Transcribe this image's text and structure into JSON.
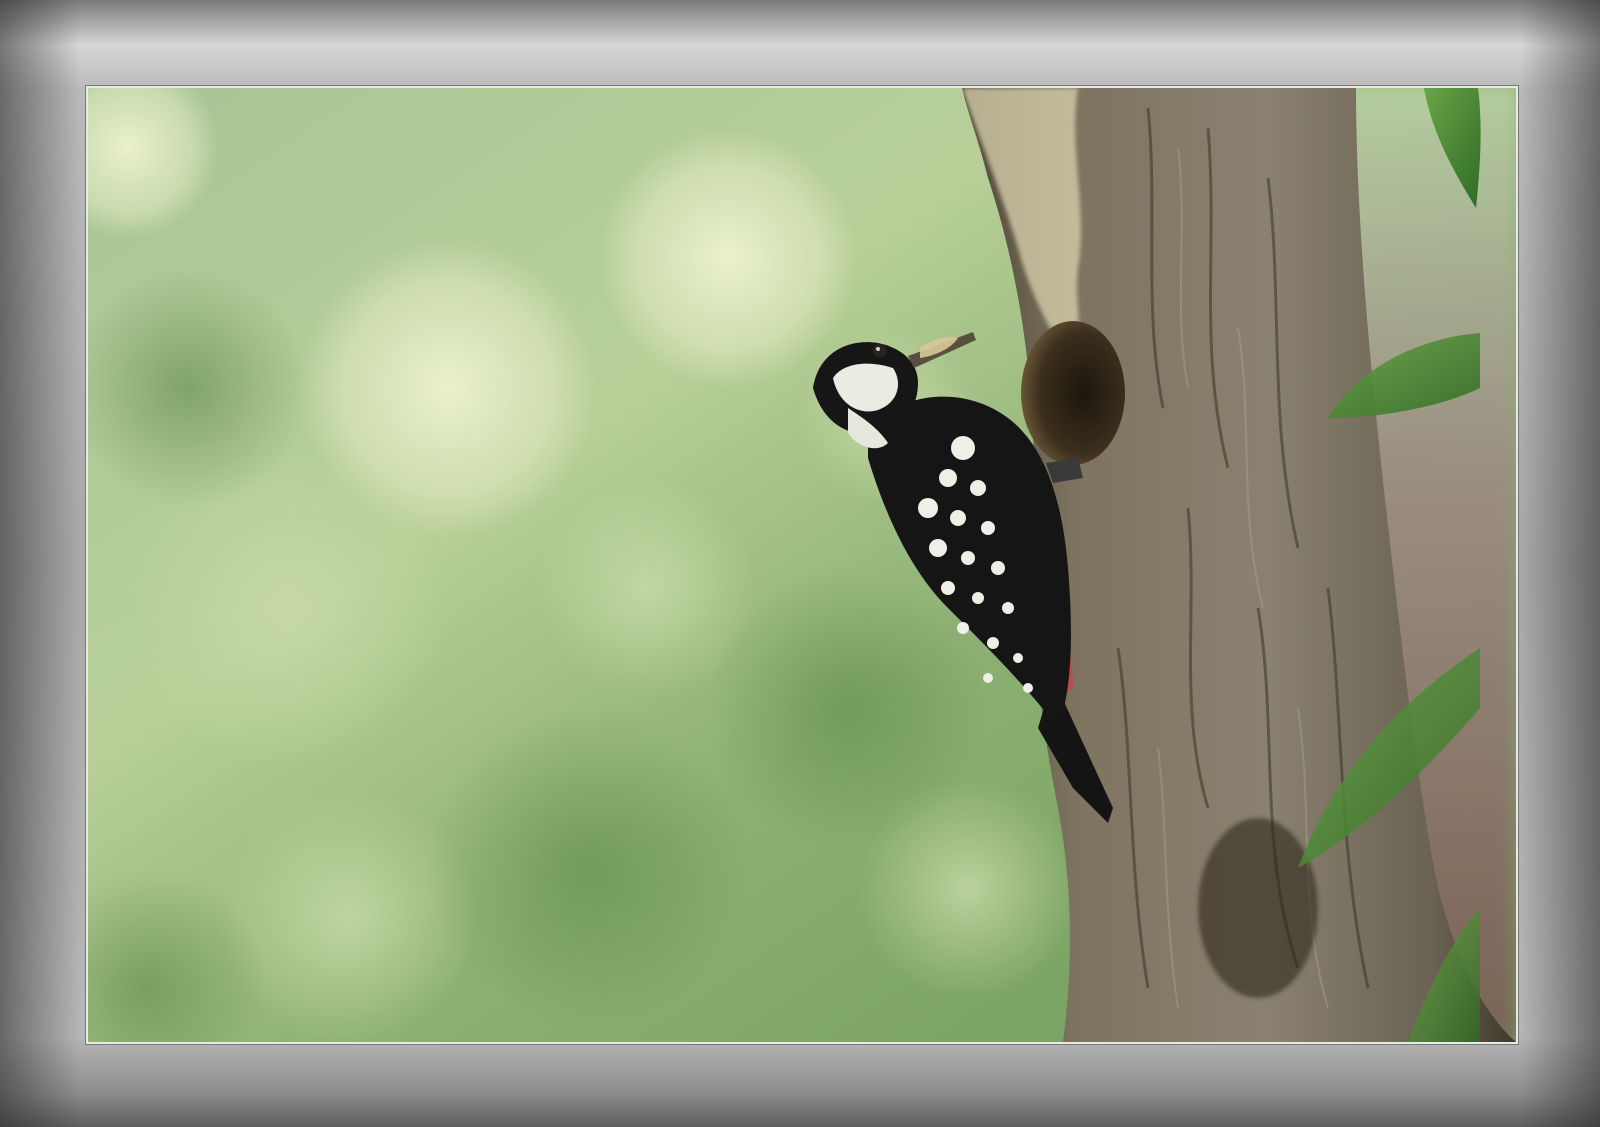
{
  "photo": {
    "subject": "woodpecker-on-tree-trunk",
    "colors": {
      "frame_light": "#d6d6d6",
      "frame_dark": "#5e5e5e",
      "background_green": "#8fb070",
      "trunk": "#6b6152",
      "bird_black": "#121212",
      "bird_white": "#f0f0ea",
      "bird_red": "#b84d4d"
    }
  }
}
